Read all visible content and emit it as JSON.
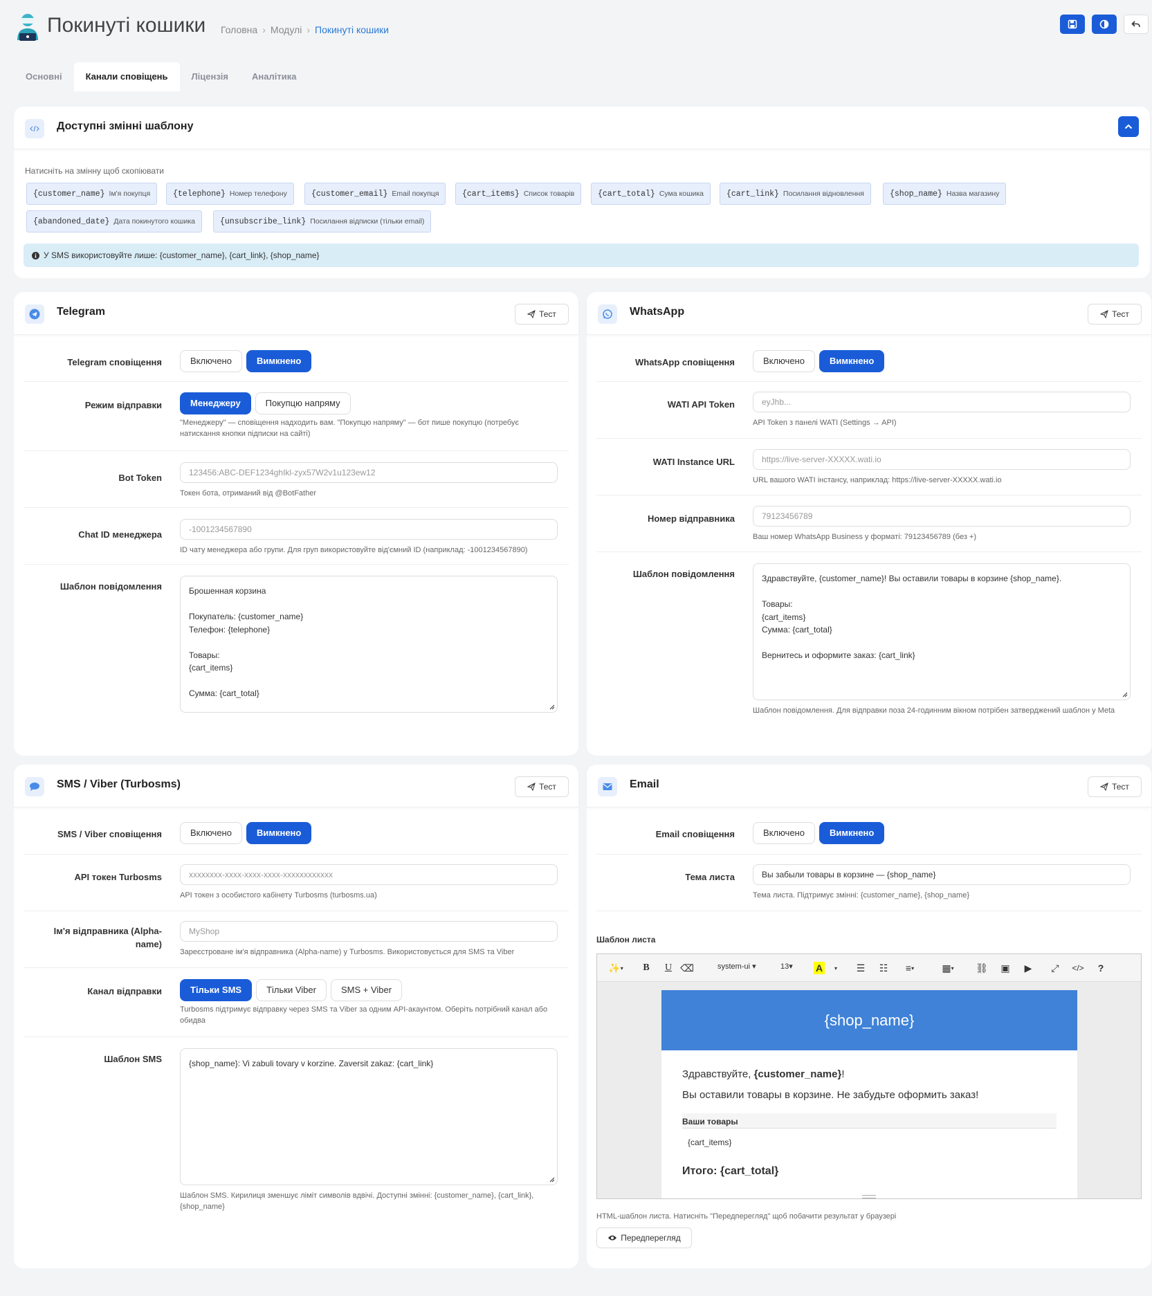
{
  "header": {
    "title": "Покинуті кошики",
    "breadcrumbs": [
      "Головна",
      "Модулі",
      "Покинуті кошики"
    ]
  },
  "tabs": [
    "Основні",
    "Канали сповіщень",
    "Ліцензія",
    "Аналітика"
  ],
  "variables": {
    "title": "Доступні змінні шаблону",
    "hint": "Натисніть на змінну щоб скопіювати",
    "items": [
      {
        "code": "{customer_name}",
        "desc": "Ім'я покупця"
      },
      {
        "code": "{telephone}",
        "desc": "Номер телефону"
      },
      {
        "code": "{customer_email}",
        "desc": "Email покупця"
      },
      {
        "code": "{cart_items}",
        "desc": "Список товарів"
      },
      {
        "code": "{cart_total}",
        "desc": "Сума кошика"
      },
      {
        "code": "{cart_link}",
        "desc": "Посилання відновлення"
      },
      {
        "code": "{shop_name}",
        "desc": "Назва магазину"
      },
      {
        "code": "{abandoned_date}",
        "desc": "Дата покинутого кошика"
      },
      {
        "code": "{unsubscribe_link}",
        "desc": "Посилання відписки (тільки email)"
      }
    ],
    "info": "У SMS використовуйте лише: {customer_name}, {cart_link}, {shop_name}"
  },
  "common": {
    "test": "Тест",
    "enabled": "Включено",
    "disabled": "Вимкнено"
  },
  "telegram": {
    "title": "Telegram",
    "notif_label": "Telegram сповіщення",
    "mode_label": "Режим відправки",
    "mode_opts": [
      "Менеджеру",
      "Покупцю напряму"
    ],
    "mode_help": "\"Менеджеру\" — сповіщення надходить вам. \"Покупцю напряму\" — бот пише покупцю (потребує натискання кнопки підписки на сайті)",
    "token_label": "Bot Token",
    "token_ph": "123456:ABC-DEF1234ghIkl-zyx57W2v1u123ew12",
    "token_help": "Токен бота, отриманий від @BotFather",
    "chat_label": "Chat ID менеджера",
    "chat_ph": "-1001234567890",
    "chat_help": "ID чату менеджера або групи. Для груп використовуйте від'ємний ID (наприклад: -1001234567890)",
    "tpl_label": "Шаблон повідомлення",
    "tpl": "Брошенная корзина\n\nПокупатель: {customer_name}\nТелефон: {telephone}\n\nТовары:\n{cart_items}\n\nСумма: {cart_total}"
  },
  "whatsapp": {
    "title": "WhatsApp",
    "notif_label": "WhatsApp сповіщення",
    "token_label": "WATI API Token",
    "token_ph": "eyJhb...",
    "token_help": "API Token з панелі WATI (Settings → API)",
    "url_label": "WATI Instance URL",
    "url_ph": "https://live-server-XXXXX.wati.io",
    "url_help": "URL вашого WATI інстансу, наприклад: https://live-server-XXXXX.wati.io",
    "sender_label": "Номер відправника",
    "sender_ph": "79123456789",
    "sender_help": "Ваш номер WhatsApp Business у форматі: 79123456789 (без +)",
    "tpl_label": "Шаблон повідомлення",
    "tpl": "Здравствуйте, {customer_name}! Вы оставили товары в корзине {shop_name}.\n\nТовары:\n{cart_items}\nСумма: {cart_total}\n\nВернитесь и оформите заказ: {cart_link}",
    "tpl_help": "Шаблон повідомлення. Для відправки поза 24-годинним вікном потрібен затверджений шаблон у Meta"
  },
  "sms": {
    "title": "SMS / Viber (Turbosms)",
    "notif_label": "SMS / Viber сповіщення",
    "token_label": "API токен Turbosms",
    "token_ph": "xxxxxxxx-xxxx-xxxx-xxxx-xxxxxxxxxxxx",
    "token_help": "API токен з особистого кабінету Turbosms (turbosms.ua)",
    "sender_label": "Ім'я відправника (Alpha-name)",
    "sender_ph": "MyShop",
    "sender_help": "Зареєстроване ім'я відправника (Alpha-name) у Turbosms. Використовується для SMS та Viber",
    "channel_label": "Канал відправки",
    "channel_opts": [
      "Тільки SMS",
      "Тільки Viber",
      "SMS + Viber"
    ],
    "channel_help": "Turbosms підтримує відправку через SMS та Viber за одним API-акаунтом. Оберіть потрібний канал або обидва",
    "tpl_label": "Шаблон SMS",
    "tpl": "{shop_name}: Vi zabuli tovary v korzine. Zaversit zakaz: {cart_link}",
    "tpl_help": "Шаблон SMS. Кирилиця зменшує ліміт символів вдвічі. Доступні змінні: {customer_name}, {cart_link}, {shop_name}"
  },
  "email": {
    "title": "Email",
    "notif_label": "Email сповіщення",
    "subject_label": "Тема листа",
    "subject": "Вы забыли товары в корзине — {shop_name}",
    "subject_help": "Тема листа. Підтримує змінні: {customer_name}, {shop_name}",
    "tpl_label": "Шаблон листа",
    "toolbar": {
      "font": "system-ui",
      "size": "13"
    },
    "mail": {
      "header": "{shop_name}",
      "greet_pre": "Здравствуйте, ",
      "greet_name": "{customer_name}",
      "greet_post": "!",
      "line": "Вы оставили товары в корзине. Не забудьте оформить заказ!",
      "items_title": "Ваши товары",
      "items": "{cart_items}",
      "total": "Итого: {cart_total}"
    },
    "tpl_help": "HTML-шаблон листа. Натисніть \"Передперегляд\" щоб побачити результат у браузері",
    "preview": "Передперегляд"
  },
  "colors": {
    "accent": "#1a5cd8",
    "info_bg": "#d9edf7",
    "mail_header": "#3f82d8"
  }
}
